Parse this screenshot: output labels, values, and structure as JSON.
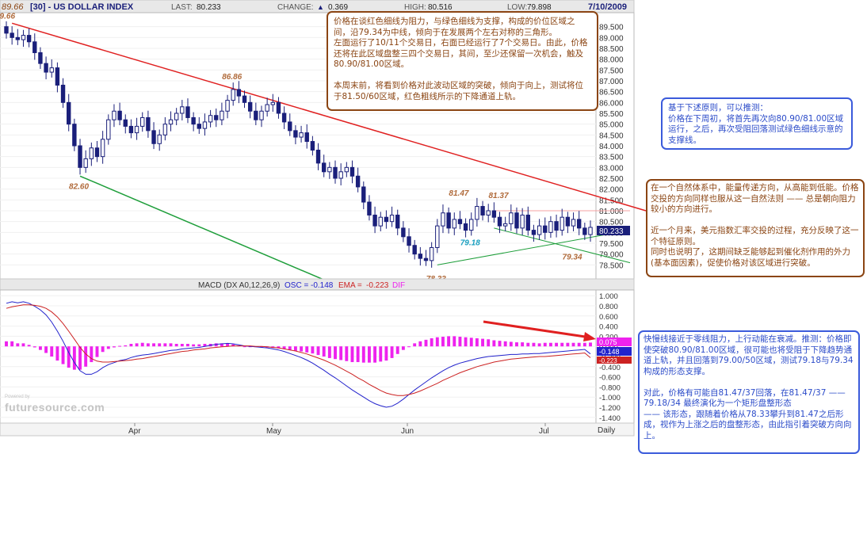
{
  "header": {
    "open_value": "89.66",
    "symbol": "[30] - US DOLLAR INDEX",
    "last_label": "LAST:",
    "last_value": "80.233",
    "change_label": "CHANGE:",
    "change_arrow": "▲",
    "change_value": "0.369",
    "high_label": "HIGH:",
    "high_value": "80.516",
    "low_label": "LOW:",
    "low_value": "79.898",
    "date": "7/10/2009"
  },
  "colors": {
    "up": "#ffffff",
    "down": "#1a1f7a",
    "resistance": "#e02020",
    "support": "#1e9e3a",
    "macd_line": "#2222cc",
    "signal_line": "#cc2222",
    "histogram": "#ee22ee",
    "note_brown": "#8b4513",
    "note_blue": "#3b5bdb"
  },
  "chart_data": [
    {
      "type": "candlestick",
      "title": "[30] - US DOLLAR INDEX",
      "ylim": [
        78.0,
        90.0
      ],
      "y_ticks": [
        "89.500",
        "89.000",
        "88.500",
        "88.000",
        "87.500",
        "87.000",
        "86.500",
        "86.000",
        "85.500",
        "85.000",
        "84.500",
        "84.000",
        "83.500",
        "83.000",
        "82.500",
        "82.000",
        "81.500",
        "81.000",
        "80.500",
        "80.000",
        "79.500",
        "79.000",
        "78.500"
      ],
      "x_ticks": [
        "Apr",
        "May",
        "Jun",
        "Jul"
      ],
      "period": "Daily",
      "last_value_label": "80.233",
      "closes": [
        89.2,
        89.0,
        88.9,
        89.1,
        88.8,
        88.3,
        87.8,
        87.4,
        87.6,
        86.8,
        86.0,
        85.0,
        84.0,
        83.0,
        83.4,
        83.9,
        83.5,
        84.3,
        85.2,
        85.6,
        85.2,
        84.9,
        84.6,
        84.9,
        85.3,
        84.7,
        84.1,
        84.5,
        85.0,
        85.2,
        85.5,
        85.8,
        85.3,
        85.0,
        84.8,
        85.1,
        85.4,
        85.2,
        85.6,
        86.1,
        86.6,
        86.3,
        86.0,
        85.6,
        85.2,
        85.6,
        85.9,
        86.0,
        85.5,
        85.1,
        84.7,
        84.4,
        84.6,
        84.2,
        83.8,
        83.2,
        82.8,
        83.0,
        82.5,
        82.8,
        83.0,
        82.6,
        82.1,
        81.4,
        80.8,
        80.3,
        80.7,
        80.5,
        80.8,
        80.2,
        79.8,
        79.4,
        79.0,
        78.8,
        78.7,
        79.3,
        80.3,
        80.9,
        80.2,
        80.6,
        80.4,
        80.1,
        80.6,
        81.2,
        80.8,
        81.0,
        80.7,
        80.3,
        80.4,
        80.9,
        80.2,
        80.8,
        80.1,
        79.9,
        80.3,
        80.0,
        80.5,
        80.1,
        80.7,
        80.3,
        80.6,
        80.2,
        79.9,
        80.233
      ],
      "annotations": [
        {
          "text": "89.66",
          "x": 0,
          "y": 89.66
        },
        {
          "text": "86.86",
          "x": 40,
          "y": 86.86
        },
        {
          "text": "82.60",
          "x": 13,
          "y": 82.6
        },
        {
          "text": "81.47",
          "x": 80,
          "y": 81.47
        },
        {
          "text": "81.37",
          "x": 87,
          "y": 81.37
        },
        {
          "text": "79.18",
          "x": 82,
          "y": 79.18
        },
        {
          "text": "79.34",
          "x": 100,
          "y": 79.34
        },
        {
          "text": "78.33",
          "x": 76,
          "y": 78.33
        }
      ]
    },
    {
      "type": "line",
      "title": "MACD (DX A0,12,26,9)",
      "legend": [
        {
          "label": "OSC =",
          "value": "-0.148",
          "color": "#2222cc"
        },
        {
          "label": "EMA =",
          "value": "-0.223",
          "color": "#cc2222"
        },
        {
          "label": "DIF",
          "value": "",
          "color": "#ee22ee"
        }
      ],
      "ylim": [
        -1.45,
        1.05
      ],
      "y_ticks": [
        "1.000",
        "0.800",
        "0.600",
        "0.400",
        "0.200",
        "0.000",
        "-0.200",
        "-0.400",
        "-0.600",
        "-0.800",
        "-1.000",
        "-1.200",
        "-1.400"
      ],
      "value_labels": [
        "0.075",
        "-0.148",
        "-0.223"
      ],
      "series": [
        {
          "name": "OSC",
          "values": [
            0.85,
            0.88,
            0.86,
            0.88,
            0.85,
            0.79,
            0.72,
            0.62,
            0.48,
            0.3,
            0.1,
            -0.12,
            -0.32,
            -0.48,
            -0.55,
            -0.55,
            -0.5,
            -0.42,
            -0.36,
            -0.32,
            -0.28,
            -0.26,
            -0.22,
            -0.19,
            -0.17,
            -0.16,
            -0.14,
            -0.12,
            -0.1,
            -0.08,
            -0.07,
            -0.05,
            -0.04,
            -0.03,
            -0.02,
            0.0,
            0.02,
            0.04,
            0.05,
            0.06,
            0.05,
            0.03,
            0.01,
            0.0,
            -0.01,
            -0.02,
            -0.03,
            -0.05,
            -0.07,
            -0.1,
            -0.14,
            -0.18,
            -0.22,
            -0.27,
            -0.33,
            -0.4,
            -0.47,
            -0.55,
            -0.62,
            -0.7,
            -0.78,
            -0.86,
            -0.93,
            -1.0,
            -1.07,
            -1.13,
            -1.17,
            -1.2,
            -1.18,
            -1.12,
            -1.04,
            -0.95,
            -0.86,
            -0.78,
            -0.7,
            -0.62,
            -0.55,
            -0.48,
            -0.42,
            -0.37,
            -0.33,
            -0.3,
            -0.27,
            -0.24,
            -0.22,
            -0.2,
            -0.19,
            -0.18,
            -0.17,
            -0.16,
            -0.16,
            -0.15,
            -0.15,
            -0.14,
            -0.14,
            -0.13,
            -0.12,
            -0.11,
            -0.1,
            -0.09,
            -0.08,
            -0.07,
            -0.06,
            -0.148
          ]
        },
        {
          "name": "EMA",
          "values": [
            0.75,
            0.78,
            0.8,
            0.82,
            0.82,
            0.81,
            0.79,
            0.75,
            0.68,
            0.58,
            0.45,
            0.3,
            0.14,
            -0.02,
            -0.15,
            -0.24,
            -0.29,
            -0.31,
            -0.31,
            -0.3,
            -0.29,
            -0.28,
            -0.27,
            -0.25,
            -0.24,
            -0.22,
            -0.2,
            -0.18,
            -0.16,
            -0.14,
            -0.12,
            -0.1,
            -0.09,
            -0.07,
            -0.06,
            -0.05,
            -0.03,
            -0.02,
            -0.01,
            0.0,
            0.01,
            0.01,
            0.01,
            0.01,
            0.0,
            0.0,
            -0.01,
            -0.02,
            -0.03,
            -0.05,
            -0.07,
            -0.09,
            -0.12,
            -0.15,
            -0.19,
            -0.23,
            -0.27,
            -0.32,
            -0.37,
            -0.43,
            -0.49,
            -0.55,
            -0.62,
            -0.68,
            -0.75,
            -0.81,
            -0.87,
            -0.92,
            -0.95,
            -0.97,
            -0.97,
            -0.95,
            -0.92,
            -0.88,
            -0.83,
            -0.78,
            -0.73,
            -0.67,
            -0.62,
            -0.57,
            -0.52,
            -0.48,
            -0.44,
            -0.4,
            -0.37,
            -0.34,
            -0.31,
            -0.29,
            -0.27,
            -0.25,
            -0.24,
            -0.23,
            -0.22,
            -0.21,
            -0.2,
            -0.2,
            -0.19,
            -0.18,
            -0.17,
            -0.16,
            -0.15,
            -0.14,
            -0.13,
            -0.223
          ]
        },
        {
          "name": "DIF",
          "type": "bar",
          "values": [
            0.1,
            0.1,
            0.06,
            0.06,
            0.03,
            -0.02,
            -0.07,
            -0.13,
            -0.2,
            -0.28,
            -0.35,
            -0.42,
            -0.46,
            -0.46,
            -0.4,
            -0.31,
            -0.21,
            -0.11,
            -0.05,
            -0.02,
            0.01,
            0.02,
            0.05,
            0.06,
            0.07,
            0.06,
            0.06,
            0.06,
            0.06,
            0.06,
            0.05,
            0.05,
            0.05,
            0.04,
            0.04,
            0.05,
            0.05,
            0.06,
            0.06,
            0.06,
            0.04,
            0.02,
            0.0,
            -0.01,
            -0.01,
            -0.02,
            -0.02,
            -0.03,
            -0.04,
            -0.05,
            -0.07,
            -0.09,
            -0.1,
            -0.12,
            -0.14,
            -0.17,
            -0.2,
            -0.23,
            -0.25,
            -0.27,
            -0.29,
            -0.31,
            -0.31,
            -0.32,
            -0.32,
            -0.32,
            -0.3,
            -0.28,
            -0.23,
            -0.15,
            -0.07,
            0.0,
            0.06,
            0.1,
            0.13,
            0.16,
            0.18,
            0.19,
            0.2,
            0.2,
            0.19,
            0.18,
            0.17,
            0.16,
            0.15,
            0.14,
            0.12,
            0.11,
            0.1,
            0.09,
            0.08,
            0.08,
            0.07,
            0.07,
            0.06,
            0.07,
            0.07,
            0.07,
            0.07,
            0.07,
            0.07,
            0.07,
            0.07,
            0.075
          ]
        }
      ]
    }
  ],
  "notes": [
    {
      "id": "note1",
      "text": "价格在谈红色细线为阻力，与绿色细线为支撑，构成的价位区域之间，沿79.34为中线，倾向于在发展两个左右对称的三角形。\n左面运行了10/11个交易日，右面已经运行了7个交易日。由此，价格还将在此区域盘整三四个交易日，其间，至少还保留一次机会，触及 80.90/81.00区域。\n\n本周末前，将看到价格对此波动区域的突破，倾向于向上，测试将位于81.50/60区域，红色粗线所示的下降通道上轨。"
    },
    {
      "id": "note2",
      "text": "基于下述原则，可以推测：\n价格在下周初，将首先再次向80.90/81.00区域运行，之后，再次受阻回落测试绿色细线示意的支撑线。"
    },
    {
      "id": "note3",
      "text": "在一个自然体系中，能量传递方向，从高能到低能。价格交投的方向同样也服从这一自然法则 —— 总是朝向阻力较小的方向进行。\n\n近一个月来，美元指数汇率交投的过程，充分反映了这一个特征原则。\n同时也说明了，这期间缺乏能够起到催化剂作用的外力(基本面因素)，促使价格对该区域进行突破。"
    },
    {
      "id": "note4",
      "text": "快慢线接近于零线阻力，上行动能在衰减。推测：价格即使突破80.90/81.00区域，很可能也将受阻于下降趋势通道上轨，并且回落到79.00/50区域，测试79.18与79.34构成的形态支撑。\n\n对此，价格有可能自81.47/37回落，在81.47/37 —— 79.18/34 最终演化为一个矩形盘整形态\n—— 该形态，跟随着价格从78.33攀升到81.47之后形成，视作为上涨之后的盘整形态，由此指引着突破方向向上。"
    }
  ],
  "watermark": {
    "small": "Powered by",
    "brand": "futuresource.com"
  }
}
